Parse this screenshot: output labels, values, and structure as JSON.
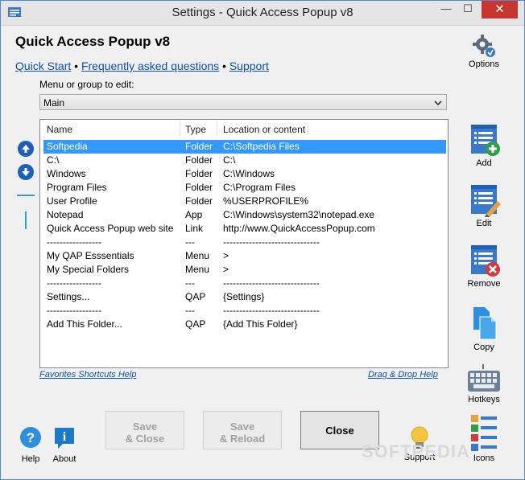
{
  "window": {
    "title": "Settings - Quick Access Popup v8",
    "min": "—",
    "max": "☐",
    "close": "✕"
  },
  "app": {
    "heading": "Quick Access Popup v8",
    "links": {
      "quick_start": "Quick Start",
      "sep1": " • ",
      "faq": "Frequently asked questions",
      "sep2": " • ",
      "support": "Support"
    },
    "menu_label": "Menu or group to edit:",
    "menu_value": "Main"
  },
  "list": {
    "headers": {
      "name": "Name",
      "type": "Type",
      "location": "Location or content"
    },
    "rows": [
      {
        "name": "Softpedia",
        "type": "Folder",
        "location": "C:\\Softpedia Files",
        "selected": true
      },
      {
        "name": "C:\\",
        "type": "Folder",
        "location": "C:\\"
      },
      {
        "name": "Windows",
        "type": "Folder",
        "location": "C:\\Windows"
      },
      {
        "name": "Program Files",
        "type": "Folder",
        "location": "C:\\Program Files"
      },
      {
        "name": "User Profile",
        "type": "Folder",
        "location": "%USERPROFILE%"
      },
      {
        "name": "Notepad",
        "type": "App",
        "location": "C:\\Windows\\system32\\notepad.exe"
      },
      {
        "name": "Quick Access Popup web site",
        "type": "Link",
        "location": "http://www.QuickAccessPopup.com"
      },
      {
        "name": "-----------------",
        "type": "---",
        "location": "------------------------------"
      },
      {
        "name": "My QAP Esssentials",
        "type": "Menu",
        "location": ">"
      },
      {
        "name": "My Special Folders",
        "type": "Menu",
        "location": ">"
      },
      {
        "name": "-----------------",
        "type": "---",
        "location": "------------------------------"
      },
      {
        "name": "Settings...",
        "type": "QAP",
        "location": "{Settings}"
      },
      {
        "name": "-----------------",
        "type": "---",
        "location": "------------------------------"
      },
      {
        "name": "Add This Folder...",
        "type": "QAP",
        "location": "{Add This Folder}"
      }
    ]
  },
  "hints": {
    "left": "Favorites Shortcuts Help",
    "right": "Drag & Drop Help"
  },
  "toolbar": {
    "options": "Options",
    "add": "Add",
    "edit": "Edit",
    "remove": "Remove",
    "copy": "Copy",
    "hotkeys": "Hotkeys",
    "icons": "Icons"
  },
  "buttons": {
    "save_close": [
      "Save",
      "& Close"
    ],
    "save_reload": [
      "Save",
      "& Reload"
    ],
    "close": "Close"
  },
  "bottom": {
    "help": "Help",
    "about": "About",
    "support": "Support"
  },
  "watermark": "SOFTPEDIA",
  "colors": {
    "selection": "#3399ff",
    "link": "#0b4fb5",
    "icon_blue": "#1e5fb8",
    "close_red": "#c7372f"
  }
}
